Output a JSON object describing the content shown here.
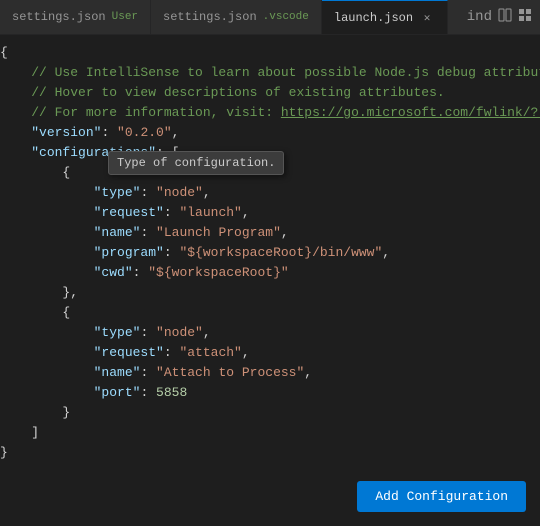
{
  "tabs": [
    {
      "id": "settings-user",
      "label": "settings.json",
      "sublabel": "User",
      "active": false,
      "modified": false
    },
    {
      "id": "settings-vscode",
      "label": "settings.json",
      "sublabel": ".vscode",
      "active": false,
      "modified": false
    },
    {
      "id": "launch-json",
      "label": "launch.json",
      "sublabel": null,
      "active": true,
      "modified": true
    }
  ],
  "tab_extra": "ind",
  "editor": {
    "lines": [
      {
        "num": "",
        "tokens": [
          {
            "text": "{",
            "class": "c-white"
          }
        ]
      },
      {
        "num": "",
        "tokens": [
          {
            "text": "    // Use IntelliSense to learn about possible Node.js debug attribute",
            "class": "c-comment"
          }
        ]
      },
      {
        "num": "",
        "tokens": [
          {
            "text": "    // Hover to view descriptions of existing attributes.",
            "class": "c-comment"
          }
        ]
      },
      {
        "num": "",
        "tokens": [
          {
            "text": "    // For more information, visit: ",
            "class": "c-comment"
          },
          {
            "text": "https://go.microsoft.com/fwlink/?li",
            "class": "c-link"
          }
        ]
      },
      {
        "num": "",
        "tokens": [
          {
            "text": "    ",
            "class": "c-white"
          },
          {
            "text": "\"version\"",
            "class": "c-key"
          },
          {
            "text": ": ",
            "class": "c-white"
          },
          {
            "text": "\"0.2.0\"",
            "class": "c-string"
          },
          {
            "text": ",",
            "class": "c-white"
          }
        ]
      },
      {
        "num": "",
        "tokens": [
          {
            "text": "    ",
            "class": "c-white"
          },
          {
            "text": "\"configurations\"",
            "class": "c-key"
          },
          {
            "text": ": [",
            "class": "c-white"
          }
        ]
      },
      {
        "num": "",
        "tokens": [
          {
            "text": "        {",
            "class": "c-white"
          }
        ]
      },
      {
        "num": "",
        "tokens": [
          {
            "text": "            ",
            "class": "c-white"
          },
          {
            "text": "\"type\"",
            "class": "c-key"
          },
          {
            "text": ": ",
            "class": "c-white"
          },
          {
            "text": "\"node\"",
            "class": "c-string"
          },
          {
            "text": ",",
            "class": "c-white"
          }
        ]
      },
      {
        "num": "",
        "tokens": [
          {
            "text": "            ",
            "class": "c-white"
          },
          {
            "text": "\"request\"",
            "class": "c-key"
          },
          {
            "text": ": ",
            "class": "c-white"
          },
          {
            "text": "\"launch\"",
            "class": "c-string"
          },
          {
            "text": ",",
            "class": "c-white"
          }
        ]
      },
      {
        "num": "",
        "tokens": [
          {
            "text": "            ",
            "class": "c-white"
          },
          {
            "text": "\"name\"",
            "class": "c-key"
          },
          {
            "text": ": ",
            "class": "c-white"
          },
          {
            "text": "\"Launch Program\"",
            "class": "c-string"
          },
          {
            "text": ",",
            "class": "c-white"
          }
        ]
      },
      {
        "num": "",
        "tokens": [
          {
            "text": "            ",
            "class": "c-white"
          },
          {
            "text": "\"program\"",
            "class": "c-key"
          },
          {
            "text": ": ",
            "class": "c-white"
          },
          {
            "text": "\"${workspaceRoot}/bin/www\"",
            "class": "c-string"
          },
          {
            "text": ",",
            "class": "c-white"
          }
        ]
      },
      {
        "num": "",
        "tokens": [
          {
            "text": "            ",
            "class": "c-white"
          },
          {
            "text": "\"cwd\"",
            "class": "c-key"
          },
          {
            "text": ": ",
            "class": "c-white"
          },
          {
            "text": "\"${workspaceRoot}\"",
            "class": "c-string"
          }
        ]
      },
      {
        "num": "",
        "tokens": [
          {
            "text": "        },",
            "class": "c-white"
          }
        ]
      },
      {
        "num": "",
        "tokens": [
          {
            "text": "        {",
            "class": "c-white"
          }
        ]
      },
      {
        "num": "",
        "tokens": [
          {
            "text": "            ",
            "class": "c-white"
          },
          {
            "text": "\"type\"",
            "class": "c-key"
          },
          {
            "text": ": ",
            "class": "c-white"
          },
          {
            "text": "\"node\"",
            "class": "c-string"
          },
          {
            "text": ",",
            "class": "c-white"
          }
        ]
      },
      {
        "num": "",
        "tokens": [
          {
            "text": "            ",
            "class": "c-white"
          },
          {
            "text": "\"request\"",
            "class": "c-key"
          },
          {
            "text": ": ",
            "class": "c-white"
          },
          {
            "text": "\"attach\"",
            "class": "c-string"
          },
          {
            "text": ",",
            "class": "c-white"
          }
        ]
      },
      {
        "num": "",
        "tokens": [
          {
            "text": "            ",
            "class": "c-white"
          },
          {
            "text": "\"name\"",
            "class": "c-key"
          },
          {
            "text": ": ",
            "class": "c-white"
          },
          {
            "text": "\"Attach to Process\"",
            "class": "c-string"
          },
          {
            "text": ",",
            "class": "c-white"
          }
        ]
      },
      {
        "num": "",
        "tokens": [
          {
            "text": "            ",
            "class": "c-white"
          },
          {
            "text": "\"port\"",
            "class": "c-key"
          },
          {
            "text": ": ",
            "class": "c-white"
          },
          {
            "text": "5858",
            "class": "c-number"
          }
        ]
      },
      {
        "num": "",
        "tokens": [
          {
            "text": "        }",
            "class": "c-white"
          }
        ]
      },
      {
        "num": "",
        "tokens": [
          {
            "text": "    ]",
            "class": "c-white"
          }
        ]
      },
      {
        "num": "",
        "tokens": [
          {
            "text": "}",
            "class": "c-white"
          }
        ]
      }
    ],
    "tooltip": "Type of configuration.",
    "add_config_label": "Add Configuration"
  }
}
